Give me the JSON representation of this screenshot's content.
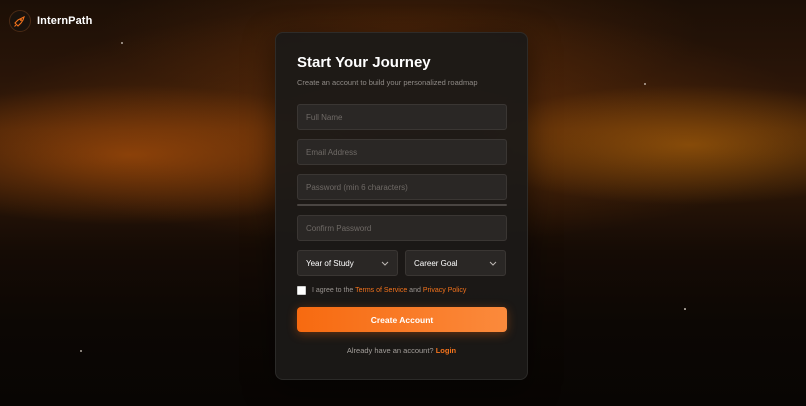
{
  "brand": {
    "name": "InternPath",
    "logo_icon": "rocket-icon"
  },
  "card": {
    "title": "Start Your Journey",
    "subtitle": "Create an account to build your personalized roadmap"
  },
  "form": {
    "full_name_placeholder": "Full Name",
    "email_placeholder": "Email Address",
    "password_placeholder": "Password (min 6 characters)",
    "confirm_password_placeholder": "Confirm Password",
    "year_of_study": "Year of Study",
    "career_goal": "Career Goal",
    "agree_prefix": "I agree to the",
    "terms_link": "Terms of Service",
    "agree_and": "and",
    "privacy_link": "Privacy Policy",
    "submit_label": "Create Account"
  },
  "footer": {
    "login_prompt": "Already have an account?",
    "login_link": "Login"
  },
  "colors": {
    "accent": "#f76a10",
    "card_bg": "#1c1917",
    "input_bg": "#2a2725"
  }
}
